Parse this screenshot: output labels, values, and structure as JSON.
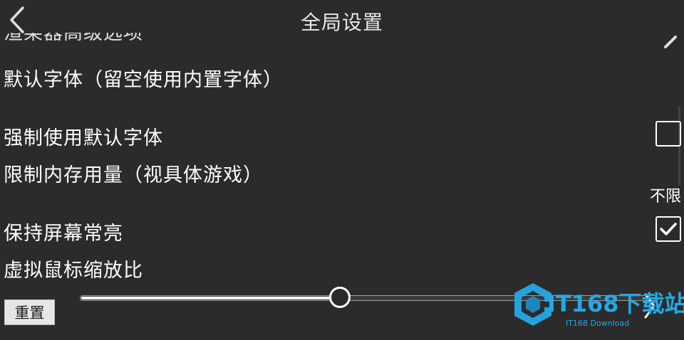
{
  "header": {
    "title": "全局设置",
    "back_icon": "chevron-left-icon"
  },
  "settings": {
    "partial_item_label": "渲染器高级选项",
    "default_font_label": "默认字体（留空使用内置字体）",
    "force_default_font": {
      "label": "强制使用默认字体",
      "checked": false
    },
    "memory_limit": {
      "label": "限制内存用量（视具体游戏）",
      "value": "不限"
    },
    "keep_screen_on": {
      "label": "保持屏幕常亮",
      "checked": true
    },
    "mouse_scale": {
      "label": "虚拟鼠标缩放比",
      "slider_fraction": 0.45
    }
  },
  "reset_button": {
    "label": "重置"
  },
  "watermark": {
    "brand": "IT168下载站",
    "subtitle": "IT168 Download",
    "color": "#25a8e6"
  },
  "colors": {
    "background": "#2b2b2b",
    "text": "#ffffff",
    "accent": "#25a8e6"
  }
}
